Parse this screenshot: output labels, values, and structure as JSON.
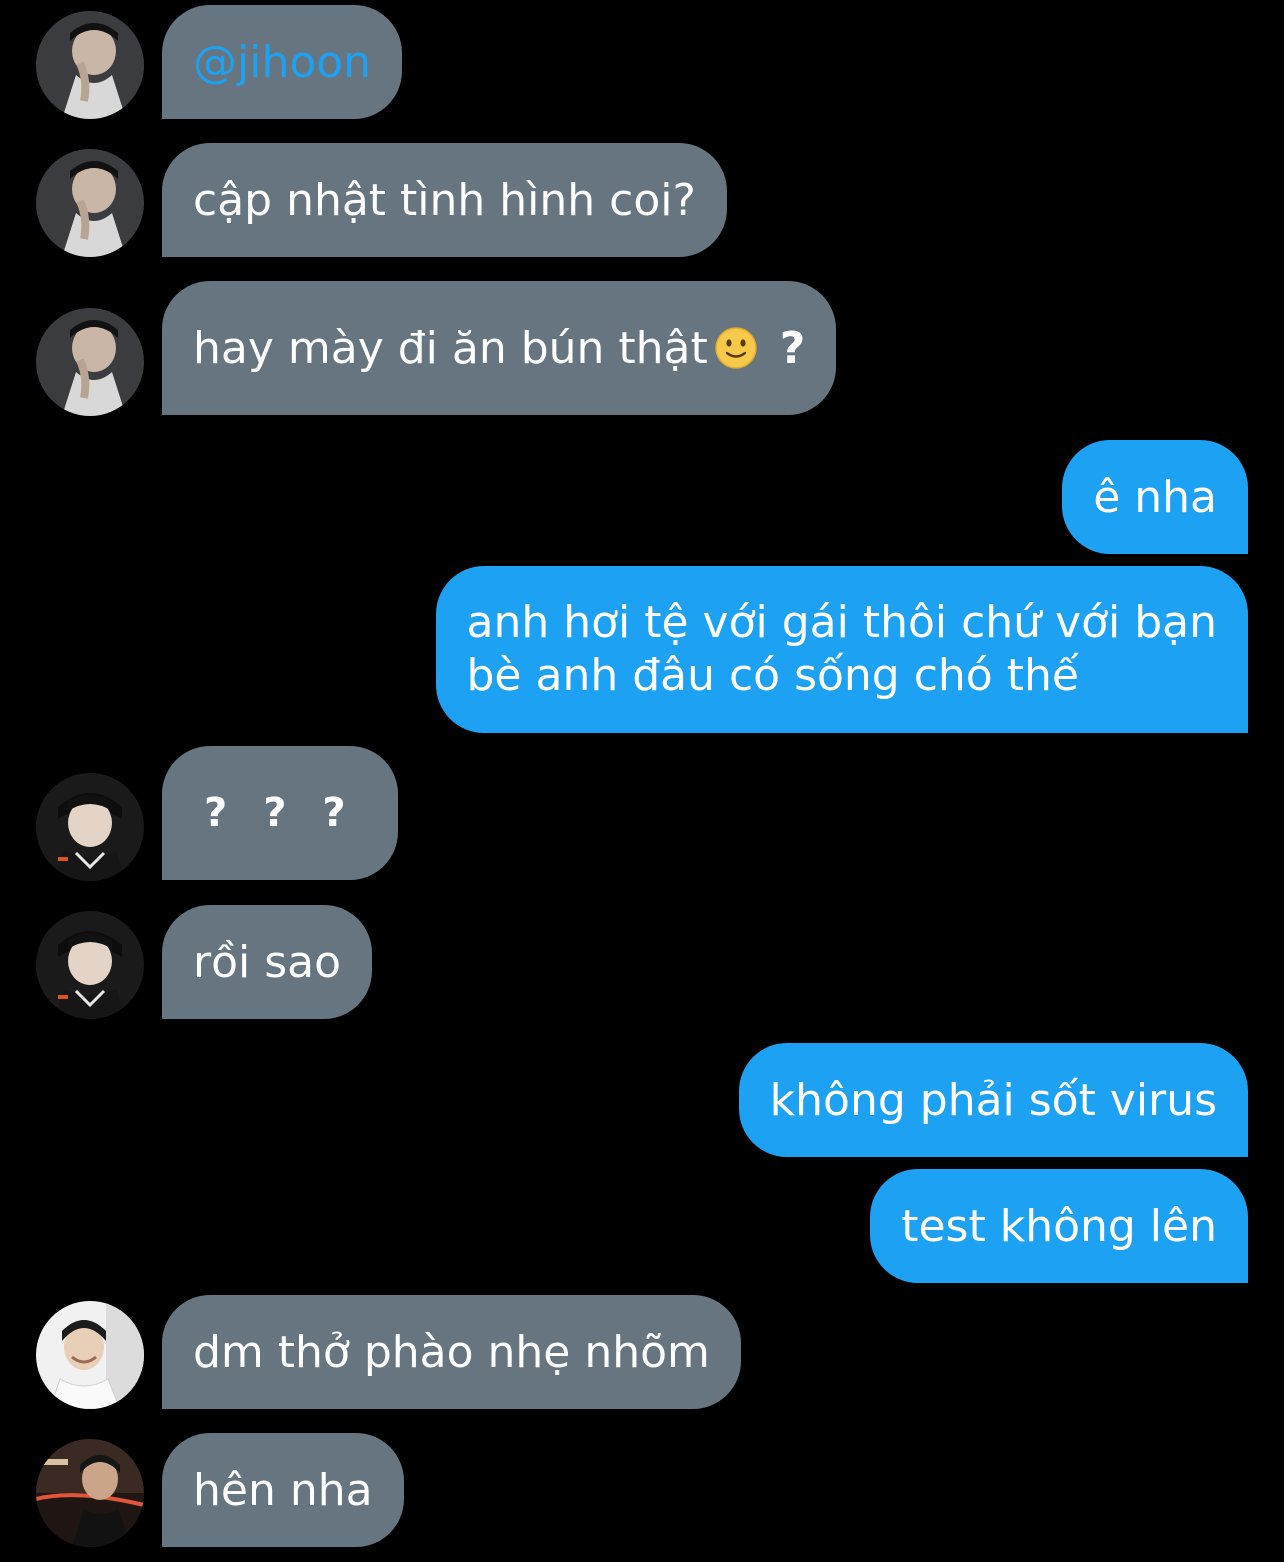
{
  "conversation": {
    "messages": [
      {
        "side": "incoming",
        "text": "@jihoon",
        "avatar": "user-a"
      },
      {
        "side": "incoming",
        "text": "cập nhật tình hình coi?",
        "avatar": "user-a"
      },
      {
        "side": "incoming",
        "text": "hay mày đi ăn bún thật",
        "emoji": "slightly-smiling-face-emoji",
        "suffix": "?",
        "avatar": "user-a"
      },
      {
        "side": "outgoing",
        "text": "ê nha"
      },
      {
        "side": "outgoing",
        "lines": [
          "anh hơi tệ với gái thôi chứ với bạn",
          "bè anh đâu có sống chó thế"
        ]
      },
      {
        "side": "incoming",
        "marks": [
          "?",
          "?",
          "?"
        ],
        "avatar": "user-b"
      },
      {
        "side": "incoming",
        "text": "rồi sao",
        "avatar": "user-b"
      },
      {
        "side": "outgoing",
        "text": "không phải sốt virus"
      },
      {
        "side": "outgoing",
        "text": "test không lên"
      },
      {
        "side": "incoming",
        "text": "dm thở phào nhẹ nhõm",
        "avatar": "user-c"
      },
      {
        "side": "incoming",
        "text": "hên nha",
        "avatar": "user-d"
      }
    ]
  },
  "colors": {
    "background": "#000000",
    "incoming_bubble": "#66757f",
    "outgoing_bubble": "#1da1f2",
    "mention": "#1da1f2",
    "text": "#ffffff"
  }
}
